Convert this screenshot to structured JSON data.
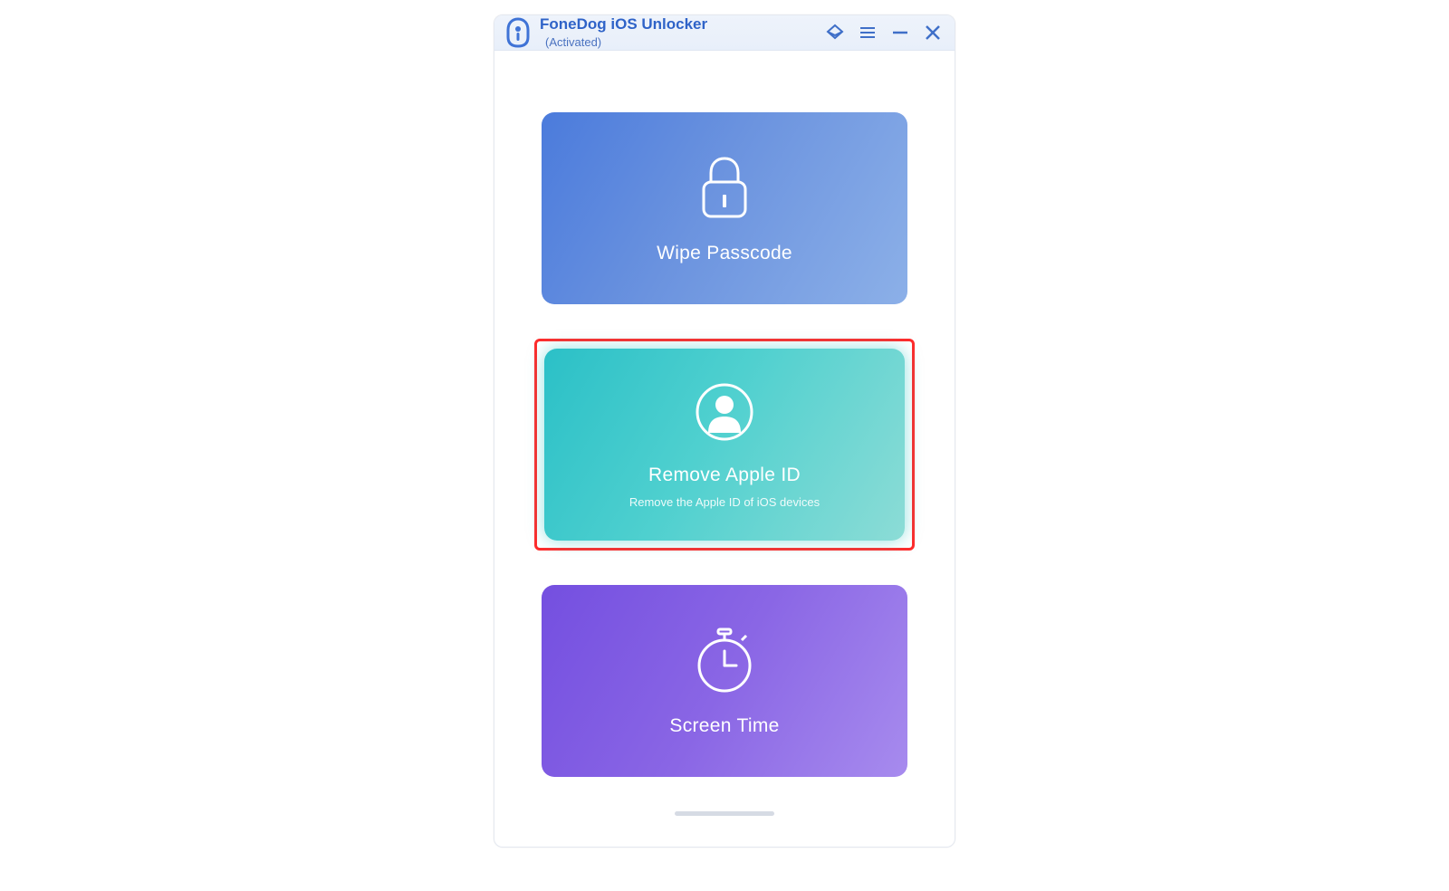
{
  "header": {
    "title": "FoneDog iOS Unlocker",
    "status": "(Activated)"
  },
  "cards": {
    "wipe": {
      "title": "Wipe Passcode"
    },
    "apple_id": {
      "title": "Remove Apple ID",
      "subtitle": "Remove the Apple ID of iOS devices"
    },
    "screen_time": {
      "title": "Screen Time"
    }
  },
  "colors": {
    "highlight_border": "#ff2a2a",
    "title_text": "#2f63c8"
  }
}
